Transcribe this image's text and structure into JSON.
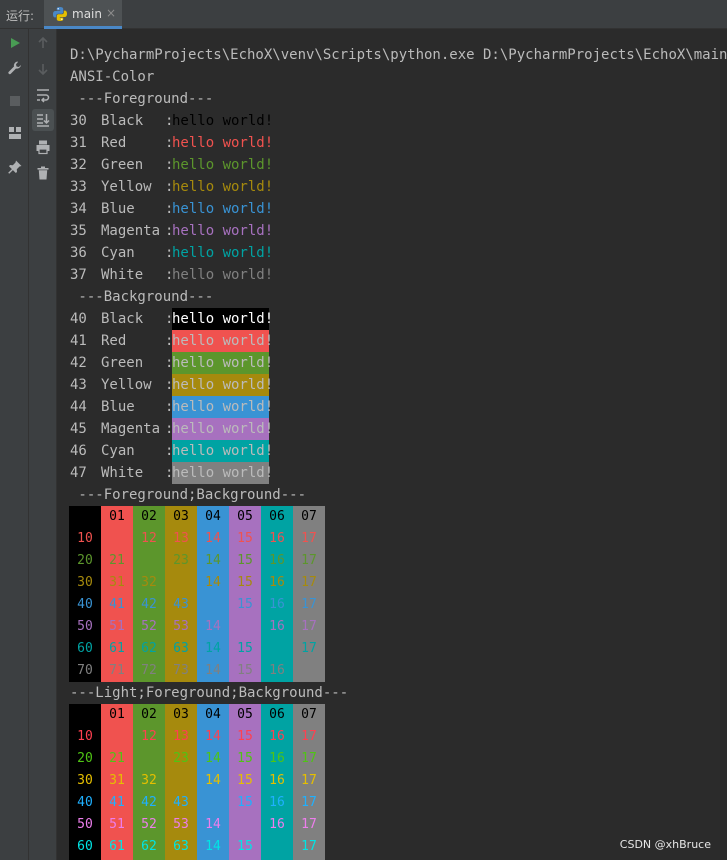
{
  "header": {
    "run_label": "运行:",
    "tab_name": "main",
    "tab_close": "×",
    "tab_icon": "python-icon"
  },
  "toolbar": {
    "left": [
      {
        "name": "run-icon",
        "active": true
      },
      {
        "name": "wrench-icon",
        "active": false
      },
      {
        "name": "stop-icon",
        "active": false
      },
      {
        "name": "layout-icon",
        "active": false
      },
      {
        "name": "pin-icon",
        "active": false
      }
    ],
    "right": [
      {
        "name": "arrow-up-icon"
      },
      {
        "name": "arrow-down-icon"
      },
      {
        "name": "soft-wrap-icon"
      },
      {
        "name": "scroll-to-end-icon",
        "selected": true
      },
      {
        "name": "print-icon"
      },
      {
        "name": "trash-icon"
      }
    ]
  },
  "console": {
    "command": "D:\\PycharmProjects\\EchoX\\venv\\Scripts\\python.exe D:\\PycharmProjects\\EchoX\\main.py",
    "title": "ANSI-Color",
    "fg_header": " ---Foreground---",
    "bg_header": " ---Background---",
    "fgbg_header": " ---Foreground;Background---",
    "light_header": "---Light;Foreground;Background---",
    "sample_text": "hello world!",
    "colors": [
      {
        "name": "Black",
        "fg": "30",
        "bg": "40",
        "hex": "#000000"
      },
      {
        "name": "Red",
        "fg": "31",
        "bg": "41",
        "hex": "#f0524f"
      },
      {
        "name": "Green",
        "fg": "32",
        "bg": "42",
        "hex": "#5c962c"
      },
      {
        "name": "Yellow",
        "fg": "33",
        "bg": "43",
        "hex": "#a68a0d"
      },
      {
        "name": "Blue",
        "fg": "34",
        "bg": "44",
        "hex": "#3993d4"
      },
      {
        "name": "Magenta",
        "fg": "35",
        "bg": "45",
        "hex": "#a771bf"
      },
      {
        "name": "Cyan",
        "fg": "36",
        "bg": "46",
        "hex": "#00a3a3"
      },
      {
        "name": "White",
        "fg": "37",
        "bg": "47",
        "hex": "#808080"
      }
    ],
    "bright_colors": [
      "#000000",
      "#ff4050",
      "#4fc414",
      "#e5bf00",
      "#1fb0ff",
      "#ed7eed",
      "#00e5e5",
      "#ffffff"
    ],
    "grid_header": [
      "01",
      "02",
      "03",
      "04",
      "05",
      "06",
      "07"
    ],
    "grid_rows": [
      {
        "label": "10",
        "cells": [
          "",
          "12",
          "13",
          "14",
          "15",
          "16",
          "17"
        ]
      },
      {
        "label": "20",
        "cells": [
          "21",
          "",
          "23",
          "14",
          "15",
          "16",
          "17"
        ]
      },
      {
        "label": "30",
        "cells": [
          "31",
          "32",
          "",
          "14",
          "15",
          "16",
          "17"
        ]
      },
      {
        "label": "40",
        "cells": [
          "41",
          "42",
          "43",
          "",
          "15",
          "16",
          "17"
        ]
      },
      {
        "label": "50",
        "cells": [
          "51",
          "52",
          "53",
          "14",
          "",
          "16",
          "17"
        ]
      },
      {
        "label": "60",
        "cells": [
          "61",
          "62",
          "63",
          "14",
          "15",
          "",
          "17"
        ]
      },
      {
        "label": "70",
        "cells": [
          "71",
          "72",
          "73",
          "14",
          "15",
          "16",
          ""
        ]
      }
    ]
  },
  "watermark": "CSDN @xhBruce"
}
